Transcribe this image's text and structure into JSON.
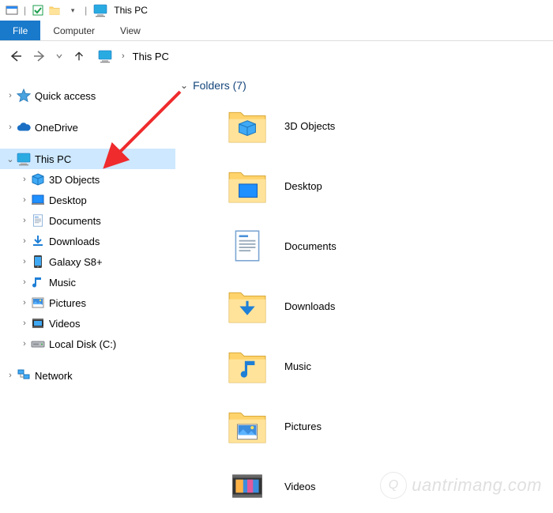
{
  "titlebar": {
    "title": "This PC"
  },
  "ribbon": {
    "file": "File",
    "computer": "Computer",
    "view": "View"
  },
  "breadcrumb": {
    "current": "This PC"
  },
  "tree": {
    "quick_access": "Quick access",
    "onedrive": "OneDrive",
    "this_pc": "This PC",
    "children": {
      "objects3d": "3D Objects",
      "desktop": "Desktop",
      "documents": "Documents",
      "downloads": "Downloads",
      "galaxy": "Galaxy S8+",
      "music": "Music",
      "pictures": "Pictures",
      "videos": "Videos",
      "localdisk": "Local Disk (C:)"
    },
    "network": "Network"
  },
  "content": {
    "group_header": "Folders (7)",
    "items": {
      "objects3d": "3D Objects",
      "desktop": "Desktop",
      "documents": "Documents",
      "downloads": "Downloads",
      "music": "Music",
      "pictures": "Pictures",
      "videos": "Videos"
    }
  },
  "watermark": "uantrimang.com"
}
